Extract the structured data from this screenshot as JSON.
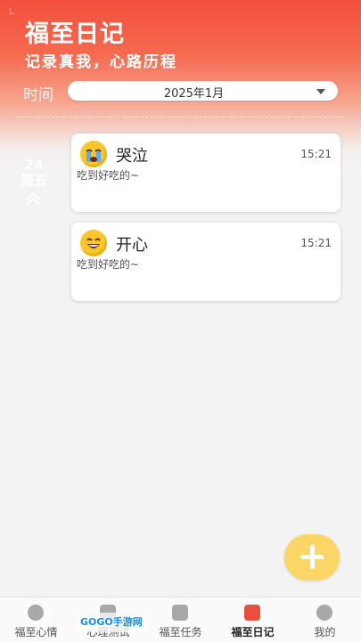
{
  "header": {
    "corner_mark": "L",
    "title": "福至日记",
    "subtitle": "记录真我，心路历程",
    "time_label": "时间",
    "month_value": "2025年1月"
  },
  "date_group": {
    "day": "24",
    "weekday": "周五"
  },
  "entries": [
    {
      "mood_icon": "crying-face-icon",
      "mood": "哭泣",
      "time": "15:21",
      "text": "吃到好吃的~"
    },
    {
      "mood_icon": "smiling-face-icon",
      "mood": "开心",
      "time": "15:21",
      "text": "吃到好吃的~"
    }
  ],
  "fab": {
    "icon": "plus-icon"
  },
  "tabbar": {
    "tabs": [
      {
        "label": "福至心情",
        "icon": "smile-icon",
        "active": false
      },
      {
        "label": "心理测试",
        "icon": "document-icon",
        "active": false
      },
      {
        "label": "福至任务",
        "icon": "checklist-icon",
        "active": false
      },
      {
        "label": "福至日记",
        "icon": "diary-icon",
        "active": true
      },
      {
        "label": "我的",
        "icon": "chat-icon",
        "active": false
      }
    ]
  },
  "watermark": "GOGO手游网",
  "colors": {
    "header_red": "#f24f3c",
    "fab_yellow": "#fbd565",
    "active_tab": "#e8503c"
  }
}
